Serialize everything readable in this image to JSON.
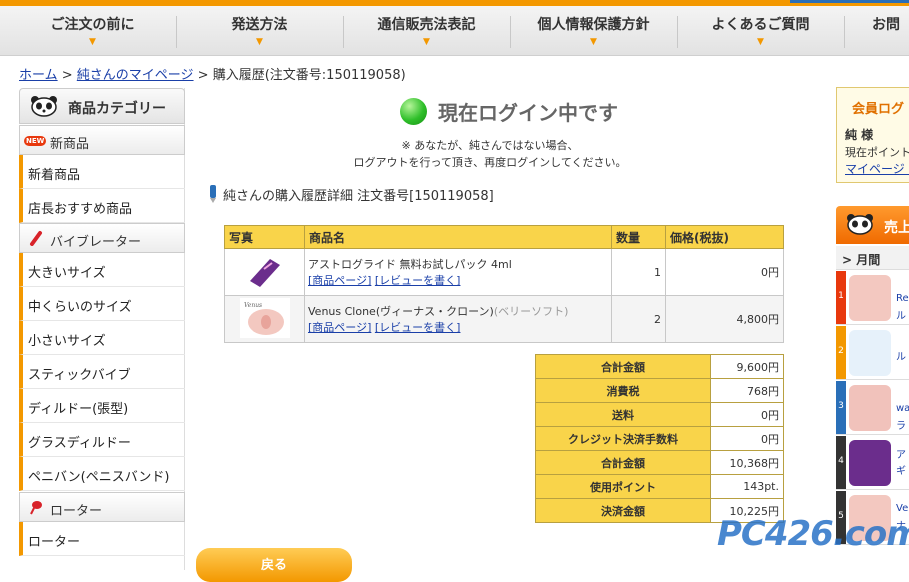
{
  "nav": {
    "items": [
      {
        "label": "ご注文の前に"
      },
      {
        "label": "発送方法"
      },
      {
        "label": "通信販売法表記"
      },
      {
        "label": "個人情報保護方針"
      },
      {
        "label": "よくあるご質問"
      },
      {
        "label": "お問"
      }
    ]
  },
  "breadcrumb": {
    "home": "ホーム",
    "sep1": " > ",
    "mypage": "純さんのマイページ",
    "sep2": " > ",
    "current": "購入履歴(注文番号:150119058)"
  },
  "sidebar": {
    "title": "商品カテゴリー",
    "sections": [
      {
        "label": "新商品",
        "badge": "NEW",
        "items": [
          "新着商品",
          "店長おすすめ商品"
        ]
      },
      {
        "label": "バイブレーター",
        "items": [
          "大きいサイズ",
          "中くらいのサイズ",
          "小さいサイズ",
          "スティックバイブ",
          "ディルドー(張型)",
          "グラスディルドー",
          "ペニバン(ペニスバンド)"
        ]
      },
      {
        "label": "ローター",
        "items": [
          "ローター"
        ]
      }
    ]
  },
  "login": {
    "title": "現在ログイン中です",
    "notice1": "※ あなたが、純さんではない場合、",
    "notice2": "ログアウトを行って頂き、再度ログインしてください。"
  },
  "order": {
    "heading": "純さんの購入履歴詳細 注文番号[150119058]",
    "columns": [
      "写真",
      "商品名",
      "数量",
      "価格(税抜)"
    ],
    "rows": [
      {
        "name": "アストログライド 無料お試しパック 4ml",
        "variant": "",
        "qty": "1",
        "price": "0円",
        "link_page": "[商品ページ]",
        "link_review": "[レビューを書く]"
      },
      {
        "name": "Venus Clone(ヴィーナス・クローン)",
        "variant": "(ベリーソフト)",
        "qty": "2",
        "price": "4,800円",
        "link_page": "[商品ページ]",
        "link_review": "[レビューを書く]"
      }
    ]
  },
  "summary": [
    {
      "label": "合計金額",
      "value": "9,600円"
    },
    {
      "label": "消費税",
      "value": "768円"
    },
    {
      "label": "送料",
      "value": "0円"
    },
    {
      "label": "クレジット決済手数料",
      "value": "0円"
    },
    {
      "label": "合計金額",
      "value": "10,368円"
    },
    {
      "label": "使用ポイント",
      "value": "143pt."
    },
    {
      "label": "決済金額",
      "value": "10,225円"
    }
  ],
  "back_label": "戻る",
  "member": {
    "title": "会員ログ",
    "name": "純 様",
    "points": "現在ポイント",
    "link": "マイページ |"
  },
  "ranking": {
    "title": "売上",
    "period": "月間",
    "items": [
      {
        "rank": "1",
        "text": "Re",
        "text2": "ル"
      },
      {
        "rank": "2",
        "text": "ル",
        "text2": ""
      },
      {
        "rank": "3",
        "text": "wa",
        "text2": "ラ"
      },
      {
        "rank": "4",
        "text": "ア",
        "text2": "ギ"
      },
      {
        "rank": "5",
        "text": "Ve",
        "text2": "ナ"
      }
    ]
  },
  "watermark": "PC426.com",
  "colors": {
    "accent": "#f39800",
    "table_head": "#f9d44a",
    "link": "#1a3fa8"
  }
}
